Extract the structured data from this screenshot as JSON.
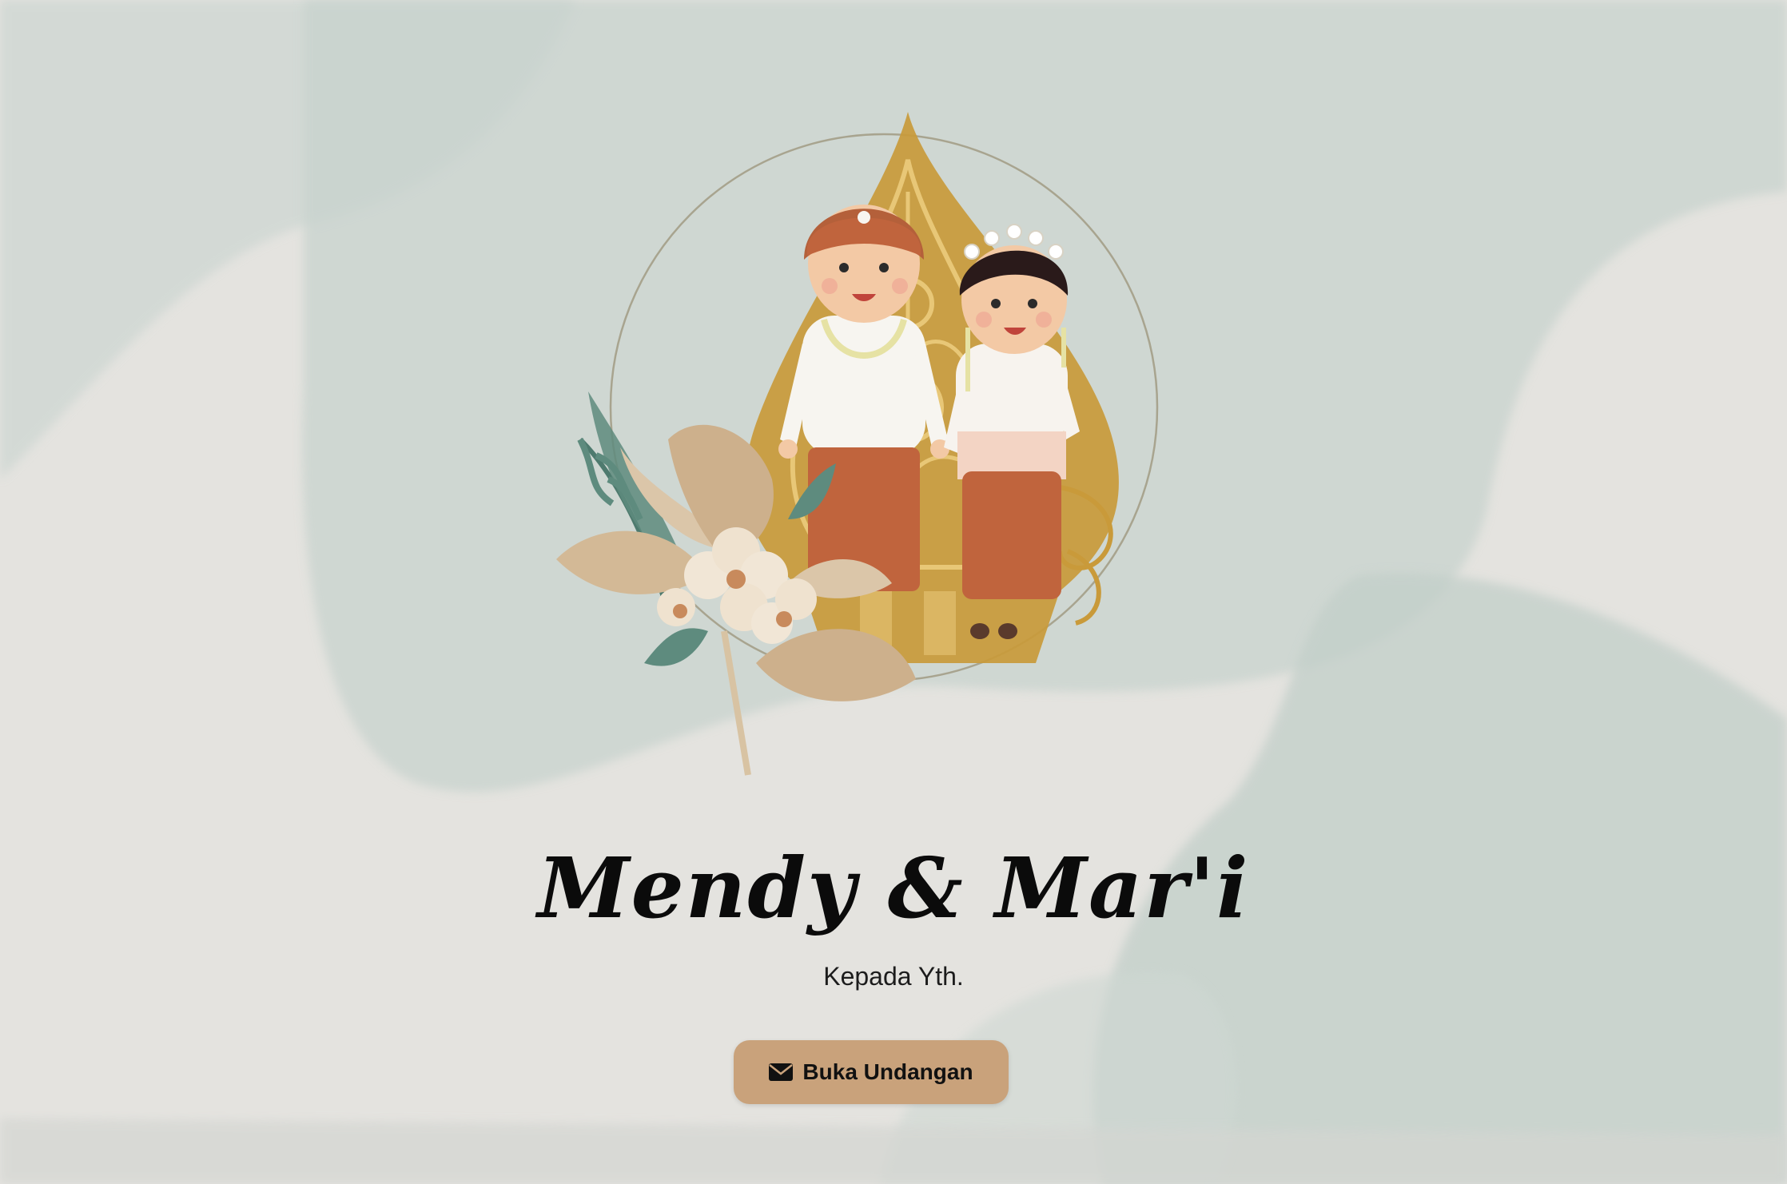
{
  "invitation": {
    "couple_names": "Mendy & Mar'i",
    "greeting": "Kepada Yth.",
    "open_button_label": "Buka Undangan",
    "open_button_icon": "envelope-icon"
  },
  "colors": {
    "background": "#e4e3df",
    "watercolor": "#b9c8c1",
    "button": "#c9a27b",
    "gold": "#c99a3a",
    "terracotta": "#c0643d"
  }
}
